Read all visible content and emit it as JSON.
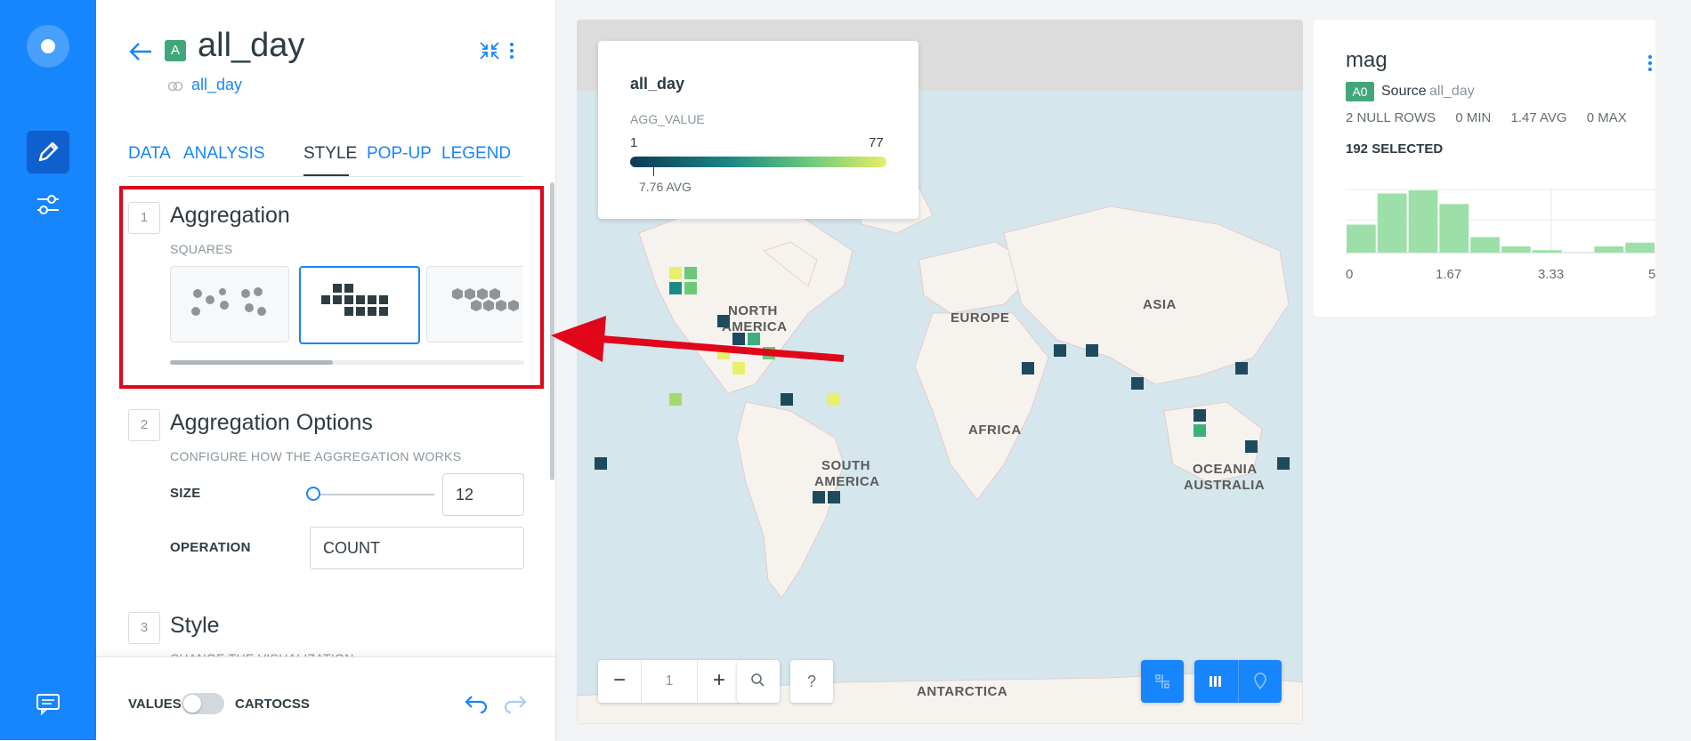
{
  "sidebar": {
    "icons": [
      "logo-icon",
      "pencil-icon",
      "sliders-icon",
      "chat-icon"
    ]
  },
  "layer": {
    "letter": "A",
    "name": "all_day",
    "source": "all_day"
  },
  "tabs": [
    {
      "label": "DATA",
      "active": false
    },
    {
      "label": "ANALYSIS",
      "active": false
    },
    {
      "label": "STYLE",
      "active": true
    },
    {
      "label": "POP-UP",
      "active": false
    },
    {
      "label": "LEGEND",
      "active": false
    }
  ],
  "sections": [
    {
      "num": "1",
      "title": "Aggregation",
      "subtitle": "SQUARES"
    },
    {
      "num": "2",
      "title": "Aggregation Options",
      "subtitle": "CONFIGURE HOW THE AGGREGATION WORKS"
    },
    {
      "num": "3",
      "title": "Style",
      "subtitle": "CHANGE THE VISUALIZATION"
    }
  ],
  "aggregation": {
    "options": [
      "points",
      "squares",
      "hexbins"
    ],
    "selected": "squares"
  },
  "options": {
    "size_label": "SIZE",
    "size_value": "12",
    "operation_label": "OPERATION",
    "operation_value": "COUNT"
  },
  "footer": {
    "values_label": "VALUES",
    "cartocss_label": "CARTOCSS"
  },
  "legend": {
    "title": "all_day",
    "field": "AGG_VALUE",
    "min": "1",
    "max": "77",
    "avg": "7.76 AVG"
  },
  "map": {
    "labels": [
      "NORTH",
      "AMERICA",
      "EUROPE",
      "ASIA",
      "AFRICA",
      "SOUTH",
      "AMERICA",
      "OCEANIA",
      "AUSTRALIA",
      "ANTARCTICA"
    ],
    "zoom": "1",
    "zoom_minus": "−",
    "zoom_plus": "+",
    "help": "?"
  },
  "widget": {
    "title": "mag",
    "badge": "A0",
    "source_label": "Source",
    "source_name": "all_day",
    "null_rows": "2 NULL ROWS",
    "min": "0 MIN",
    "avg": "1.47 AVG",
    "max": "0 MAX",
    "selected": "192 SELECTED",
    "ticks": [
      "0",
      "1.67",
      "3.33",
      "5"
    ],
    "bins": [
      0.45,
      0.95,
      1.0,
      0.78,
      0.25,
      0.1,
      0.04,
      0.0,
      0.1,
      0.16
    ]
  },
  "colors": {
    "accent": "#1785fb",
    "badge": "#41a77a",
    "highlight": "#e1061a"
  }
}
